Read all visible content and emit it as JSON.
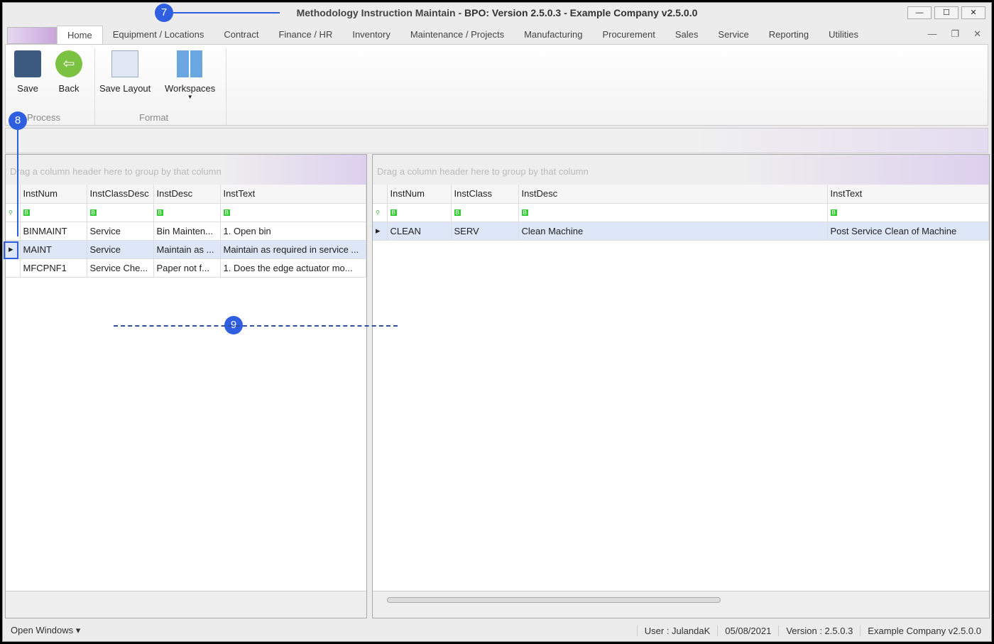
{
  "window": {
    "title": "Methodology Instruction Maintain - ",
    "title_bold": "BPO: Version 2.5.0.3 - Example Company v2.5.0.0"
  },
  "tabs": [
    "Home",
    "Equipment / Locations",
    "Contract",
    "Finance / HR",
    "Inventory",
    "Maintenance / Projects",
    "Manufacturing",
    "Procurement",
    "Sales",
    "Service",
    "Reporting",
    "Utilities"
  ],
  "ribbon": {
    "save": "Save",
    "back": "Back",
    "save_layout": "Save Layout",
    "workspaces": "Workspaces",
    "group_process": "Process",
    "group_format": "Format"
  },
  "group_hint": "Drag a column header here to group by that column",
  "left_grid": {
    "columns": [
      "InstNum",
      "InstClassDesc",
      "InstDesc",
      "InstText"
    ],
    "rows": [
      [
        "BINMAINT",
        "Service",
        "Bin Mainten...",
        "1. Open bin"
      ],
      [
        "MAINT",
        "Service",
        "Maintain as ...",
        "Maintain as required in service ..."
      ],
      [
        "MFCPNF1",
        "Service Che...",
        "Paper not f...",
        "1. Does the edge actuator mo..."
      ]
    ]
  },
  "right_grid": {
    "columns": [
      "InstNum",
      "InstClass",
      "InstDesc",
      "InstText"
    ],
    "rows": [
      [
        "CLEAN",
        "SERV",
        "Clean Machine",
        "Post Service Clean of Machine"
      ]
    ]
  },
  "filter_icon": "ABC",
  "status": {
    "open_windows": "Open Windows ▾",
    "user": "User : JulandaK",
    "date": "05/08/2021",
    "version": "Version : 2.5.0.3",
    "company": "Example Company v2.5.0.0"
  },
  "annotations": [
    "7",
    "8",
    "9"
  ]
}
